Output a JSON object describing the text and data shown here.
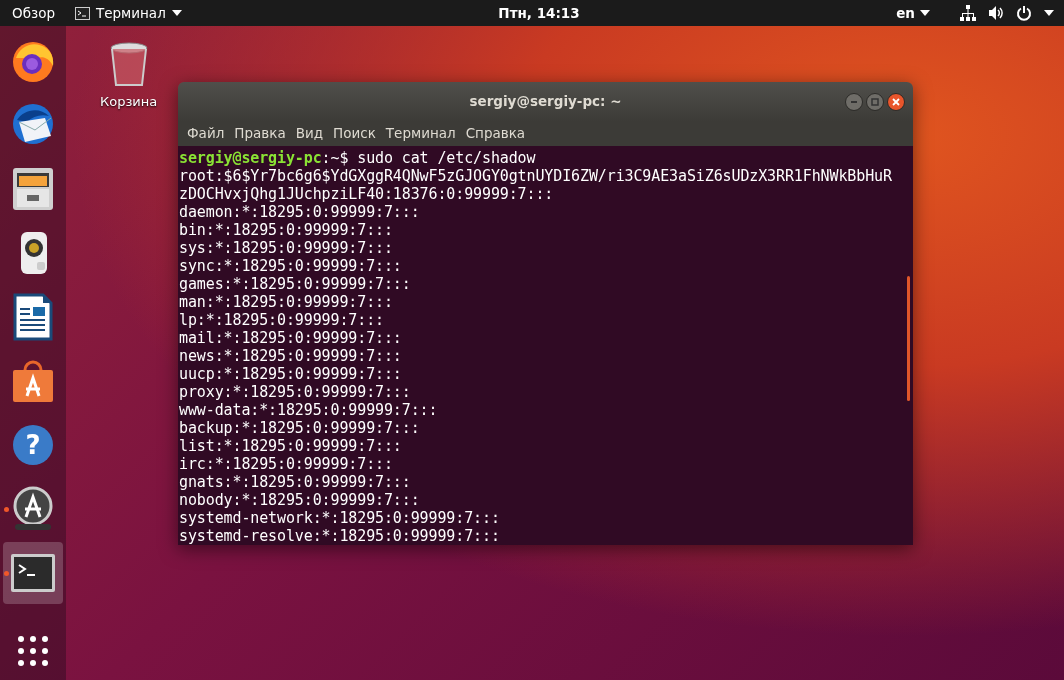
{
  "top_bar": {
    "activities": "Обзор",
    "app_menu": "Терминал",
    "clock": "Птн, 14:13",
    "language": "en"
  },
  "dock": {
    "items": [
      {
        "kind": "firefox",
        "running": false,
        "selected": false
      },
      {
        "kind": "thunderbird",
        "running": false,
        "selected": false
      },
      {
        "kind": "files",
        "running": false,
        "selected": false
      },
      {
        "kind": "rhythmbox",
        "running": false,
        "selected": false
      },
      {
        "kind": "writer",
        "running": false,
        "selected": false
      },
      {
        "kind": "software",
        "running": false,
        "selected": false
      },
      {
        "kind": "help",
        "glyph": "?",
        "running": false,
        "selected": false
      },
      {
        "kind": "updater",
        "running": true,
        "selected": false
      },
      {
        "kind": "terminal",
        "running": true,
        "selected": true
      }
    ]
  },
  "desktop": {
    "icons": [
      {
        "label": "Корзина"
      }
    ]
  },
  "terminal": {
    "title": "sergiy@sergiy-pc: ~",
    "menu": [
      "Файл",
      "Правка",
      "Вид",
      "Поиск",
      "Терминал",
      "Справка"
    ],
    "prompt": {
      "user_host": "sergiy@sergiy-pc",
      "rest": ":~$ sudo cat /etc/shadow"
    },
    "lines": [
      "root:$6$Yr7bc6g6$YdGXggR4QNwF5zGJOGY0gtnUYDI6ZW/ri3C9AE3aSiZ6sUDzX3RR1FhNWkBbHuR",
      "zDOCHvxjQhg1JUchpziLF40:18376:0:99999:7:::",
      "daemon:*:18295:0:99999:7:::",
      "bin:*:18295:0:99999:7:::",
      "sys:*:18295:0:99999:7:::",
      "sync:*:18295:0:99999:7:::",
      "games:*:18295:0:99999:7:::",
      "man:*:18295:0:99999:7:::",
      "lp:*:18295:0:99999:7:::",
      "mail:*:18295:0:99999:7:::",
      "news:*:18295:0:99999:7:::",
      "uucp:*:18295:0:99999:7:::",
      "proxy:*:18295:0:99999:7:::",
      "www-data:*:18295:0:99999:7:::",
      "backup:*:18295:0:99999:7:::",
      "list:*:18295:0:99999:7:::",
      "irc:*:18295:0:99999:7:::",
      "gnats:*:18295:0:99999:7:::",
      "nobody:*:18295:0:99999:7:::",
      "systemd-network:*:18295:0:99999:7:::",
      "systemd-resolve:*:18295:0:99999:7:::"
    ]
  }
}
